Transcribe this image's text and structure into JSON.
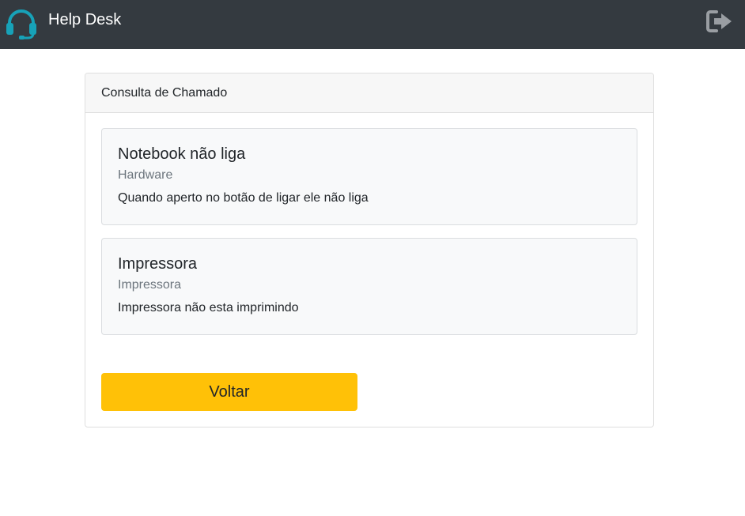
{
  "navbar": {
    "brand": "Help Desk",
    "logo_icon": "headset-icon",
    "logout_icon": "sign-out-icon"
  },
  "card": {
    "header": "Consulta de Chamado",
    "tickets": [
      {
        "title": "Notebook não liga",
        "category": "Hardware",
        "description": "Quando aperto no botão de ligar ele não liga"
      },
      {
        "title": "Impressora",
        "category": "Impressora",
        "description": "Impressora não esta imprimindo"
      }
    ],
    "back_label": "Voltar"
  },
  "colors": {
    "navbar": "#343a40",
    "logo": "#17a2b8",
    "button": "#ffc107",
    "ticket_bg": "#f8f9fa",
    "muted_text": "#6c757d"
  }
}
